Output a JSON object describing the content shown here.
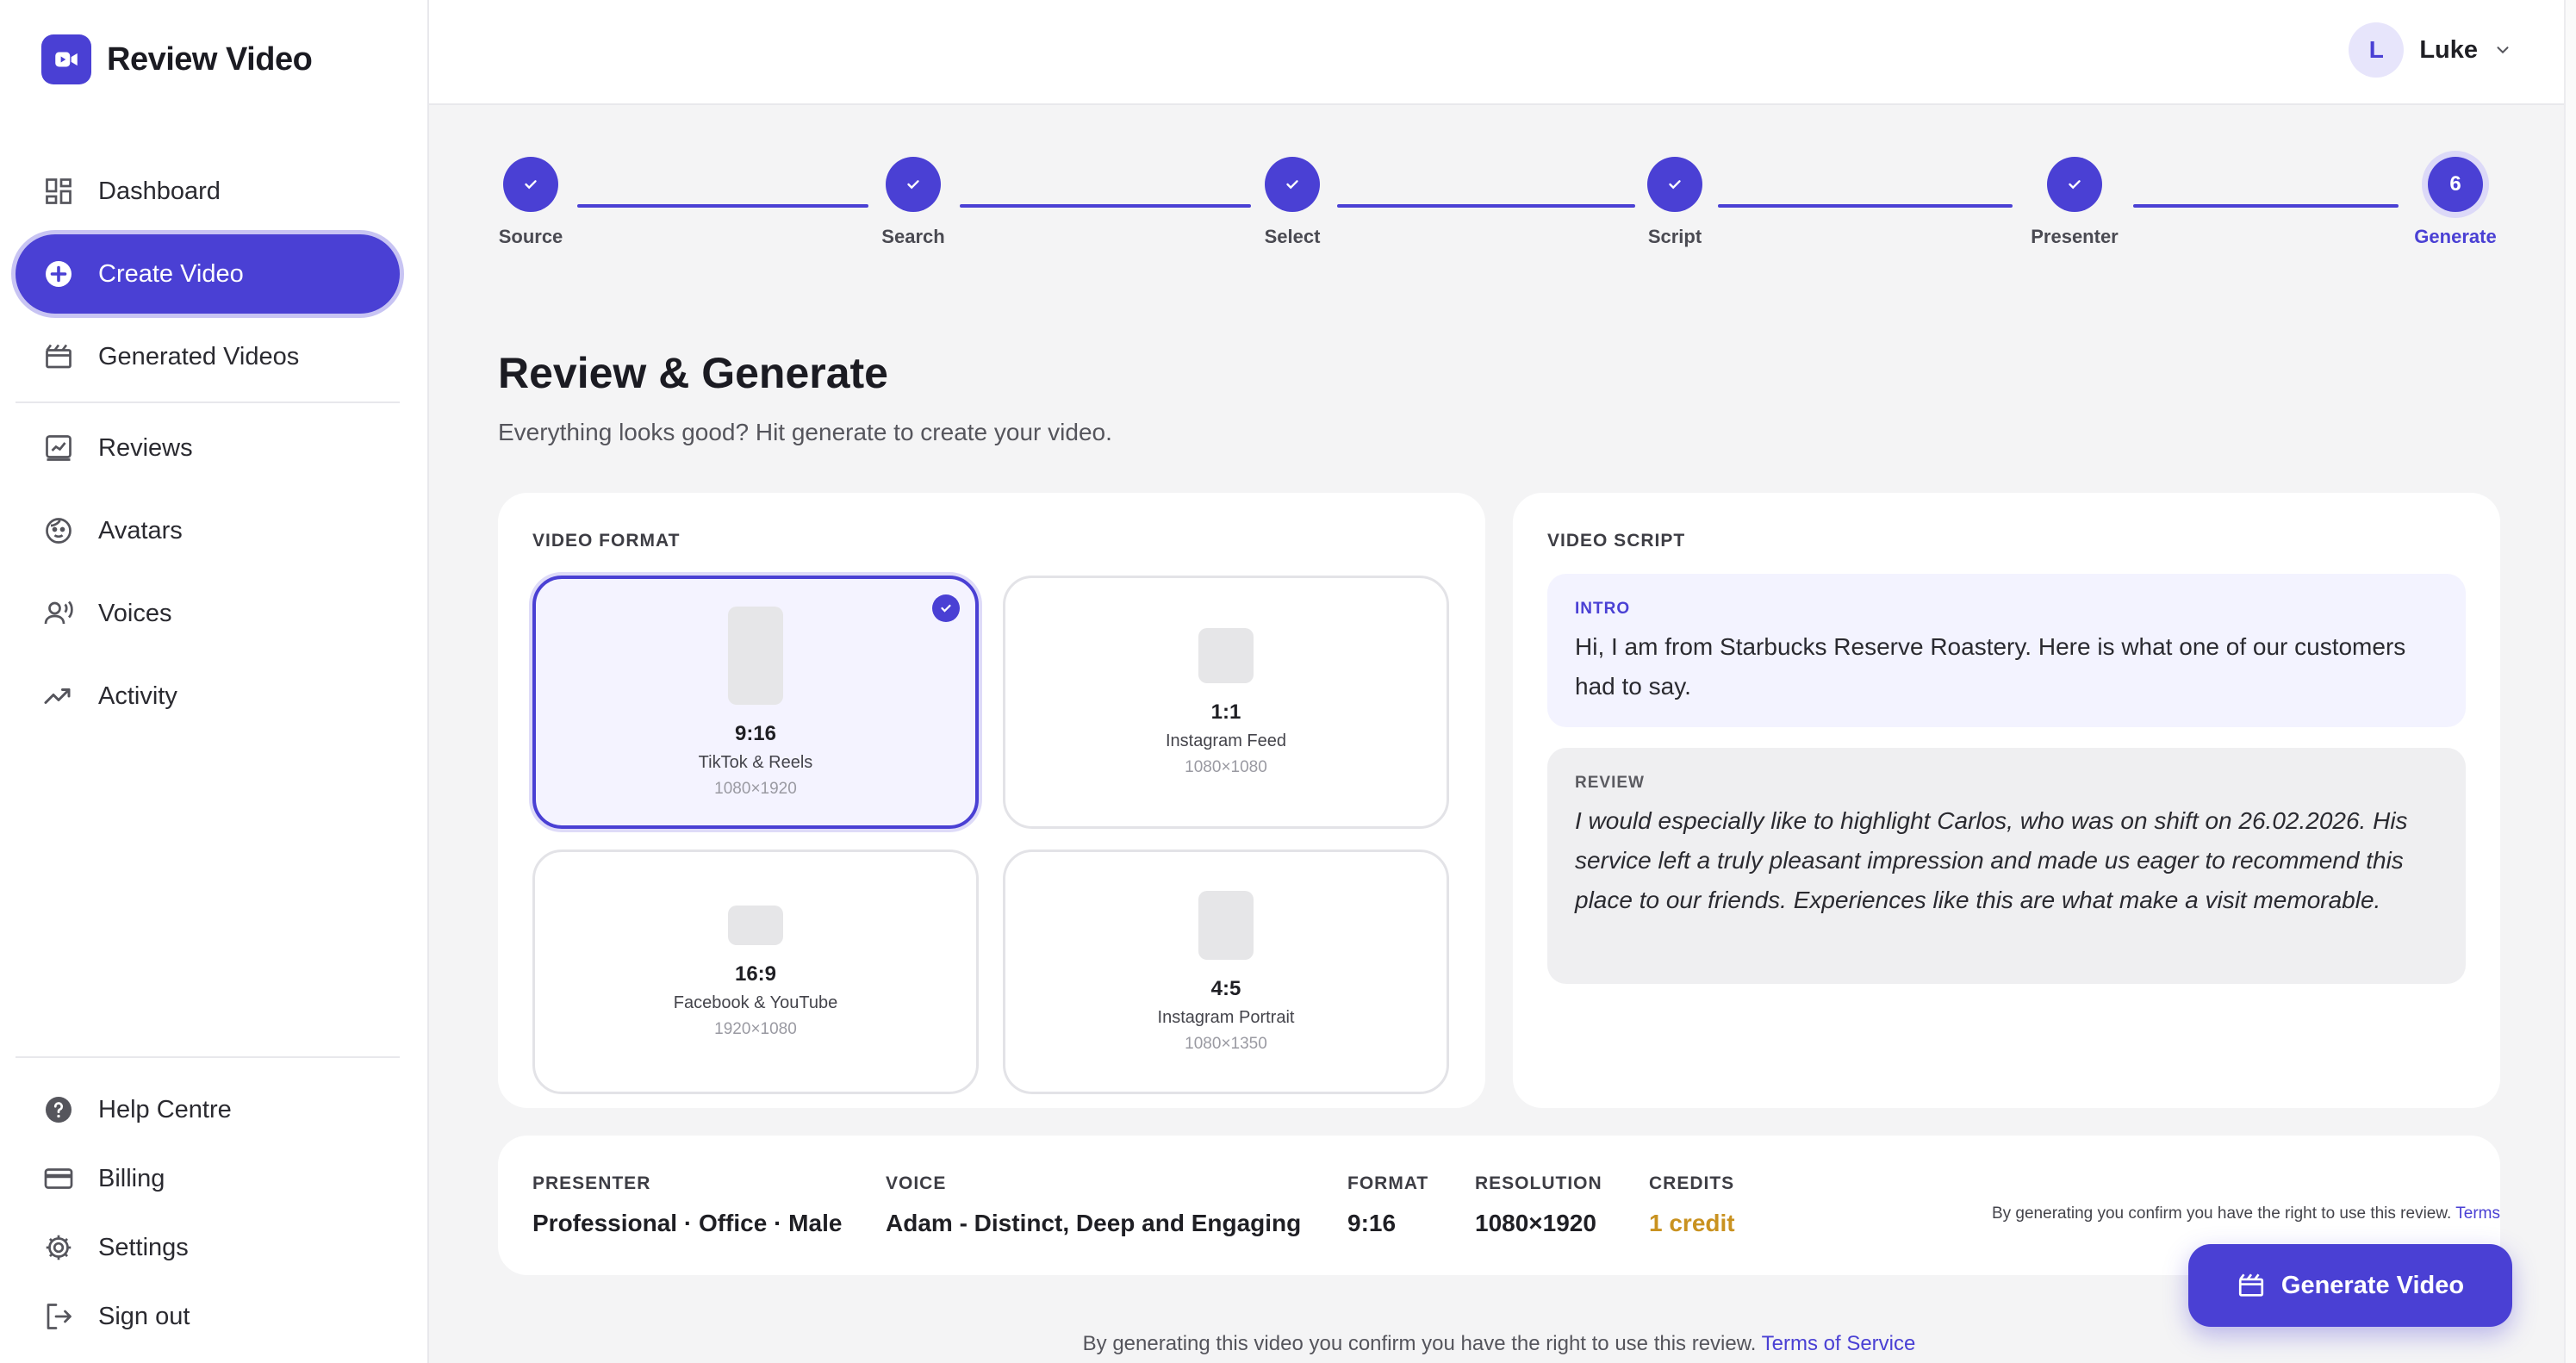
{
  "brand": {
    "name": "Review Video"
  },
  "nav": {
    "primary": [
      {
        "label": "Dashboard",
        "icon": "dashboard-icon"
      },
      {
        "label": "Create Video",
        "icon": "plus-circle-icon",
        "active": true
      },
      {
        "label": "Generated Videos",
        "icon": "clapperboard-icon"
      }
    ],
    "secondary": [
      {
        "label": "Reviews",
        "icon": "review-icon"
      },
      {
        "label": "Avatars",
        "icon": "face-icon"
      },
      {
        "label": "Voices",
        "icon": "voice-icon"
      },
      {
        "label": "Activity",
        "icon": "activity-icon"
      }
    ],
    "bottom": [
      {
        "label": "Help Centre",
        "icon": "help-icon"
      },
      {
        "label": "Billing",
        "icon": "card-icon"
      },
      {
        "label": "Settings",
        "icon": "gear-icon"
      },
      {
        "label": "Sign out",
        "icon": "sign-out-icon"
      }
    ]
  },
  "user": {
    "initial": "L",
    "name": "Luke"
  },
  "stepper": {
    "steps": [
      {
        "label": "Source",
        "done": true
      },
      {
        "label": "Search",
        "done": true
      },
      {
        "label": "Select",
        "done": true
      },
      {
        "label": "Script",
        "done": true
      },
      {
        "label": "Presenter",
        "done": true
      },
      {
        "label": "Generate",
        "number": "6",
        "current": true
      }
    ]
  },
  "page": {
    "title": "Review & Generate",
    "subtitle": "Everything looks good? Hit generate to create your video."
  },
  "format": {
    "label": "VIDEO FORMAT",
    "options": [
      {
        "ratio": "9:16",
        "name": "TikTok & Reels",
        "resolution": "1080×1920",
        "selected": true
      },
      {
        "ratio": "1:1",
        "name": "Instagram Feed",
        "resolution": "1080×1080"
      },
      {
        "ratio": "16:9",
        "name": "Facebook & YouTube",
        "resolution": "1920×1080"
      },
      {
        "ratio": "4:5",
        "name": "Instagram Portrait",
        "resolution": "1080×1350"
      }
    ]
  },
  "script": {
    "label": "VIDEO SCRIPT",
    "intro": {
      "tag": "INTRO",
      "text": "Hi, I am from Starbucks Reserve Roastery. Here is what one of our customers had to say."
    },
    "review": {
      "tag": "REVIEW",
      "text": "I would especially like to highlight Carlos, who was on shift on 26.02.2026. His service left a truly pleasant impression and made us eager to recommend this place to our friends. Experiences like this are what make a visit memorable."
    }
  },
  "summary": {
    "presenter": {
      "label": "PRESENTER",
      "value": "Professional · Office · Male"
    },
    "voice": {
      "label": "VOICE",
      "value": "Adam - Distinct, Deep and Engaging"
    },
    "format": {
      "label": "FORMAT",
      "value": "9:16"
    },
    "resolution": {
      "label": "RESOLUTION",
      "value": "1080×1920"
    },
    "credits": {
      "label": "CREDITS",
      "value": "1 credit"
    },
    "note": "By generating you confirm you have the right to use this review.",
    "note_link": "Terms"
  },
  "generate_button": {
    "label": "Generate Video"
  },
  "footer": {
    "note": "By generating this video you confirm you have the right to use this review.",
    "link": "Terms of Service"
  },
  "colors": {
    "accent": "#4a40d4",
    "credit": "#c99220"
  }
}
